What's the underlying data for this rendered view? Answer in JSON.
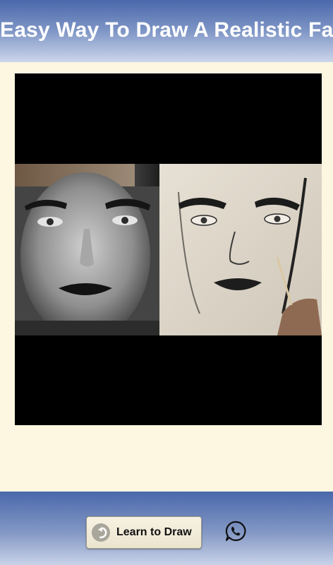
{
  "header": {
    "title": "Easy Way To Draw A Realistic Face"
  },
  "main": {
    "image_icon": "drawing-comparison-image"
  },
  "footer": {
    "learn_button_label": "Learn to Draw",
    "learn_button_icon": "back-arrow-icon",
    "share_icon": "whatsapp-icon"
  },
  "colors": {
    "header_gradient_top": "#4a68ab",
    "header_gradient_bottom": "#cdd6ea",
    "background": "#fdf6e1",
    "button_face": "#f3eedc"
  }
}
